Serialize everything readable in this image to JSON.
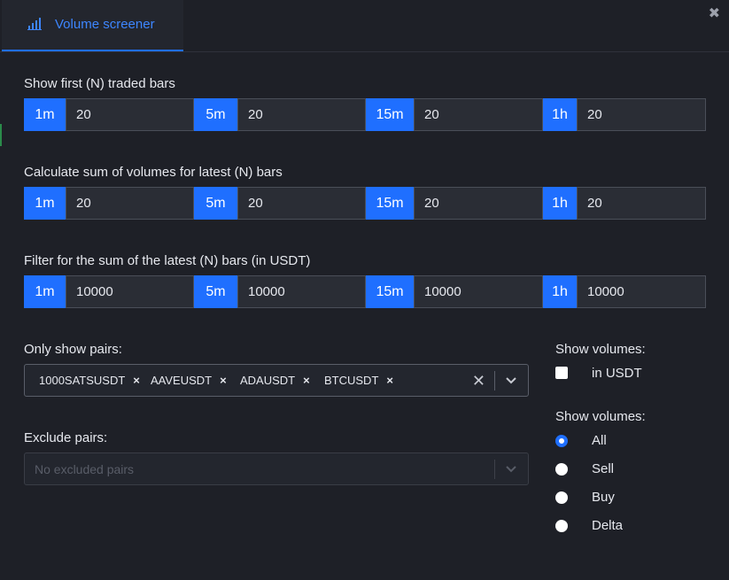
{
  "tab": {
    "label": "Volume screener",
    "icon": "bar-chart-icon"
  },
  "close_icon": "✖",
  "sections": [
    {
      "label": "Show first (N) traded bars",
      "fields": [
        {
          "tf": "1m",
          "value": "20"
        },
        {
          "tf": "5m",
          "value": "20"
        },
        {
          "tf": "15m",
          "value": "20"
        },
        {
          "tf": "1h",
          "value": "20"
        }
      ]
    },
    {
      "label": "Calculate sum of volumes for latest (N) bars",
      "fields": [
        {
          "tf": "1m",
          "value": "20"
        },
        {
          "tf": "5m",
          "value": "20"
        },
        {
          "tf": "15m",
          "value": "20"
        },
        {
          "tf": "1h",
          "value": "20"
        }
      ]
    },
    {
      "label": "Filter for the sum of the latest (N) bars (in USDT)",
      "fields": [
        {
          "tf": "1m",
          "value": "10000"
        },
        {
          "tf": "5m",
          "value": "10000"
        },
        {
          "tf": "15m",
          "value": "10000"
        },
        {
          "tf": "1h",
          "value": "10000"
        }
      ]
    }
  ],
  "only_pairs": {
    "label": "Only show pairs:",
    "chips": [
      "1000SATSUSDT",
      "AAVEUSDT",
      "ADAUSDT",
      "BTCUSDT"
    ],
    "chip_remove": "×",
    "clear": "✕"
  },
  "exclude_pairs": {
    "label": "Exclude pairs:",
    "placeholder": "No excluded pairs"
  },
  "show_volumes_unit": {
    "label": "Show volumes:",
    "option": "in USDT",
    "checked": false
  },
  "show_volumes_type": {
    "label": "Show volumes:",
    "options": [
      "All",
      "Sell",
      "Buy",
      "Delta"
    ],
    "selected": "All"
  },
  "colors": {
    "accent": "#1f6fff",
    "background": "#1e2027",
    "input": "#2a2d35"
  }
}
